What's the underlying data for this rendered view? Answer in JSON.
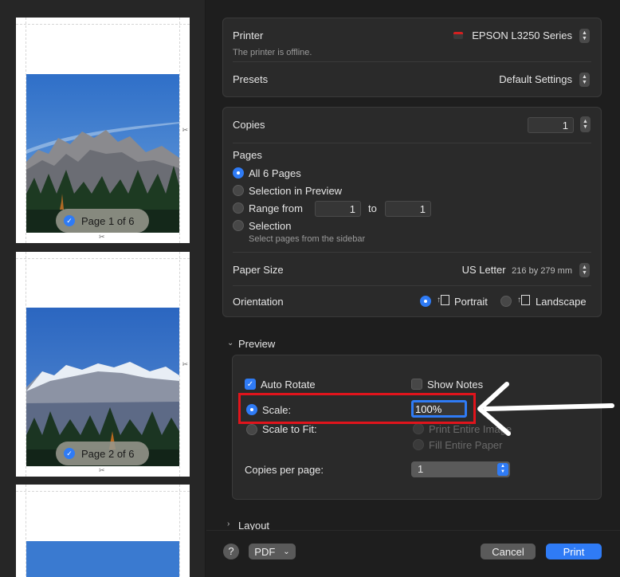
{
  "thumbnails": [
    {
      "label": "Page 1 of 6"
    },
    {
      "label": "Page 2 of 6"
    }
  ],
  "printer": {
    "label": "Printer",
    "value": "EPSON L3250 Series",
    "status": "The printer is offline."
  },
  "presets": {
    "label": "Presets",
    "value": "Default Settings"
  },
  "copies": {
    "label": "Copies",
    "value": "1"
  },
  "pages": {
    "label": "Pages",
    "options": [
      {
        "label": "All 6 Pages"
      },
      {
        "label": "Selection in Preview"
      },
      {
        "label": "Range from"
      },
      {
        "label": "Selection"
      }
    ],
    "range_from": "1",
    "range_to_label": "to",
    "range_to": "1",
    "selection_hint": "Select pages from the sidebar"
  },
  "paper_size": {
    "label": "Paper Size",
    "value": "US Letter",
    "dims": "216 by 279 mm"
  },
  "orientation": {
    "label": "Orientation",
    "portrait": "Portrait",
    "landscape": "Landscape"
  },
  "preview": {
    "header": "Preview",
    "auto_rotate": "Auto Rotate",
    "show_notes": "Show Notes",
    "scale_label": "Scale:",
    "scale_value": "100%",
    "scale_to_fit": "Scale to Fit:",
    "print_entire_image": "Print Entire Image",
    "fill_entire_paper": "Fill Entire Paper",
    "copies_per_page_label": "Copies per page:",
    "copies_per_page_value": "1"
  },
  "layout": {
    "header": "Layout"
  },
  "footer": {
    "help": "?",
    "pdf": "PDF",
    "cancel": "Cancel",
    "print": "Print"
  },
  "colors": {
    "accent": "#2f7bf5",
    "annotation": "#e0141c"
  }
}
